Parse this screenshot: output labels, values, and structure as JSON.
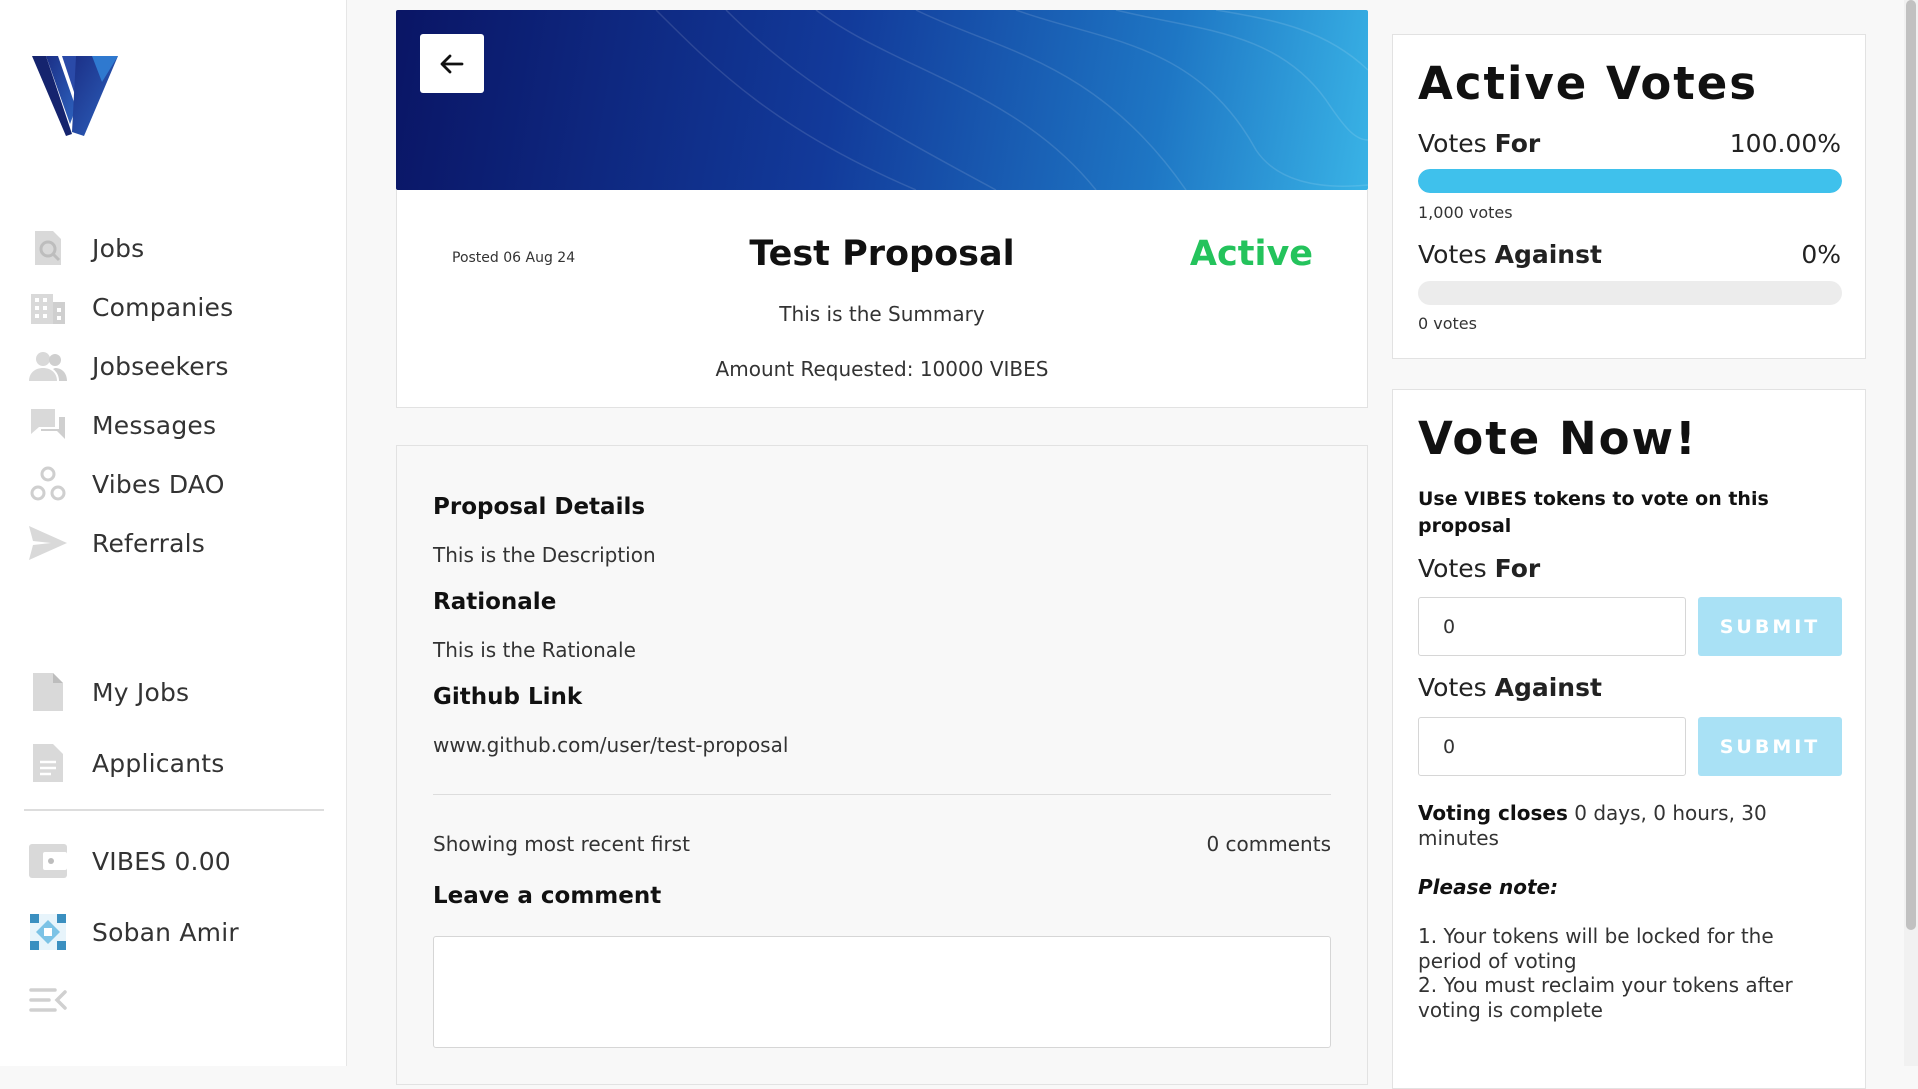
{
  "sidebar": {
    "nav": [
      {
        "label": "Jobs",
        "icon": "search-document-icon"
      },
      {
        "label": "Companies",
        "icon": "building-icon"
      },
      {
        "label": "Jobseekers",
        "icon": "people-icon"
      },
      {
        "label": "Messages",
        "icon": "chat-icon"
      },
      {
        "label": "Vibes DAO",
        "icon": "dao-icon"
      },
      {
        "label": "Referrals",
        "icon": "send-icon"
      },
      {
        "label": "My Jobs",
        "icon": "file-icon"
      },
      {
        "label": "Applicants",
        "icon": "document-icon"
      }
    ],
    "wallet_label": "VIBES 0.00",
    "user_name": "Soban Amir"
  },
  "proposal": {
    "posted": "Posted 06 Aug 24",
    "title": "Test Proposal",
    "status": "Active",
    "summary": "This is the Summary",
    "amount": "Amount Requested: 10000 VIBES",
    "details_heading": "Proposal Details",
    "description": "This is the Description",
    "rationale_heading": "Rationale",
    "rationale": "This is the Rationale",
    "github_heading": "Github Link",
    "github_link": "www.github.com/user/test-proposal",
    "sort_text": "Showing most recent first",
    "comments_count": "0 comments",
    "leave_comment": "Leave a comment"
  },
  "active_votes": {
    "title": "Active Votes",
    "votes_word": "Votes",
    "for_label": "For",
    "for_pct": "100.00%",
    "for_fraction": 1.0,
    "for_count": "1,000 votes",
    "against_label": "Against",
    "against_pct": "0%",
    "against_fraction": 0.0,
    "against_count": "0 votes"
  },
  "vote_now": {
    "title": "Vote Now!",
    "subtitle": "Use VIBES tokens to vote on this proposal",
    "votes_word": "Votes",
    "for_label": "For",
    "against_label": "Against",
    "for_value": "0",
    "against_value": "0",
    "submit_label": "SUBMIT",
    "closes_label": "Voting closes",
    "closes_value": " 0 days, 0 hours, 30 minutes",
    "note_heading": "Please note:",
    "note_1": "1. Your tokens will be locked for the period of voting",
    "note_2": "2. You must reclaim your tokens after voting is complete"
  },
  "colors": {
    "accent": "#3fc1ec",
    "status_active": "#24c35c",
    "submit_disabled": "#a9e1f5"
  }
}
